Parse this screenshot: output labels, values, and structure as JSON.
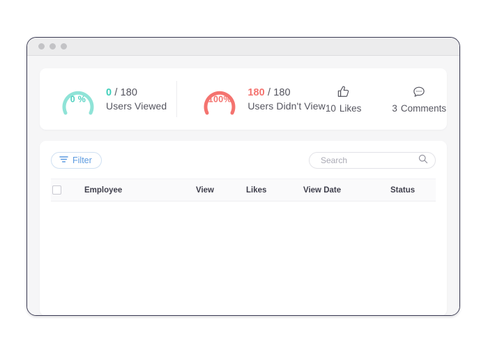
{
  "window": {
    "titlebar_dots": [
      "dot-1",
      "dot-2",
      "dot-3"
    ]
  },
  "stats": {
    "viewed": {
      "gauge_percent_label": "0 %",
      "percent_value": 0,
      "count": "0",
      "total": "/ 180",
      "caption": "Users Viewed",
      "accent_color": "#3fcfba"
    },
    "not_viewed": {
      "gauge_percent_label": "100%",
      "percent_value": 100,
      "count": "180",
      "total": "/ 180",
      "caption": "Users Didn't View",
      "accent_color": "#f4736f"
    },
    "engagement": [
      {
        "icon": "thumbs-up-icon",
        "count": "10",
        "label": "Likes"
      },
      {
        "icon": "comment-bubble-icon",
        "count": "3",
        "label": "Comments"
      }
    ]
  },
  "toolbar": {
    "filter_label": "Filter",
    "filter_icon": "filter-lines-icon",
    "search_placeholder": "Search",
    "search_value": "",
    "search_icon": "search-icon"
  },
  "table": {
    "columns": [
      {
        "key": "check",
        "label": ""
      },
      {
        "key": "employee",
        "label": "Employee"
      },
      {
        "key": "view",
        "label": "View"
      },
      {
        "key": "likes",
        "label": "Likes"
      },
      {
        "key": "viewdate",
        "label": "View Date"
      },
      {
        "key": "status",
        "label": "Status"
      }
    ],
    "rows": []
  }
}
